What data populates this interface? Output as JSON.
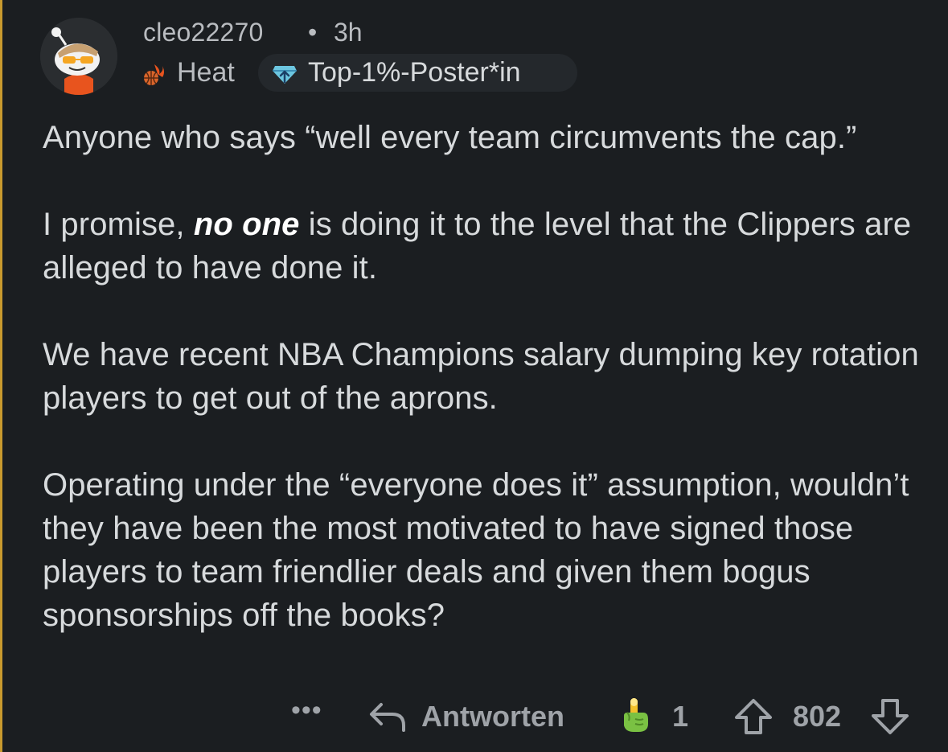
{
  "comment": {
    "author": "cleo22270",
    "separator": "•",
    "age": "3h",
    "flair_icon": "basketball-fire-icon",
    "flair": "Heat",
    "badge_icon": "top-poster-diamond-icon",
    "badge": "Top-1%-Poster*in",
    "paragraphs": [
      {
        "text": "Anyone who says “well every team circumvents the cap.”"
      },
      {
        "before": "I promise, ",
        "emphasis": "no one",
        "after": " is doing it to the level that the Clippers are alleged to have done it."
      },
      {
        "text": "We have recent NBA Champions salary dumping key rotation players to get out of the aprons."
      },
      {
        "text": "Operating under the “everyone does it” assumption, wouldn’t they have been the most motivated to have signed those players to team friendlier deals and given them bogus sponsorships off the books?"
      }
    ]
  },
  "actions": {
    "more": "•••",
    "reply_icon": "reply-arrow-icon",
    "reply_label": "Antworten",
    "award_icon": "pointing-hand-award-icon",
    "award_count": "1",
    "upvote_icon": "upvote-arrow-icon",
    "score": "802",
    "downvote_icon": "downvote-arrow-icon"
  },
  "colors": {
    "background": "#1b1e21",
    "thread_line": "#c99a2e",
    "text": "#d7dadc",
    "meta_text": "#9fa3a8"
  }
}
